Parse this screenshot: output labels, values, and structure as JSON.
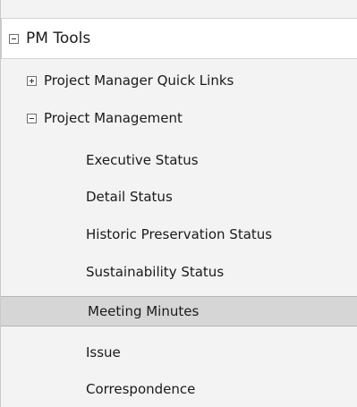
{
  "pm_tools": {
    "title": "PM Tools",
    "sections": [
      {
        "label": "Project Manager Quick Links",
        "expanded": false
      },
      {
        "label": "Project Management",
        "expanded": true
      }
    ],
    "items": [
      {
        "label": "Executive Status"
      },
      {
        "label": "Detail Status"
      },
      {
        "label": "Historic Preservation Status"
      },
      {
        "label": "Sustainability Status"
      },
      {
        "label": "Meeting Minutes",
        "selected": true
      },
      {
        "label": "Issue"
      },
      {
        "label": "Correspondence"
      }
    ]
  }
}
